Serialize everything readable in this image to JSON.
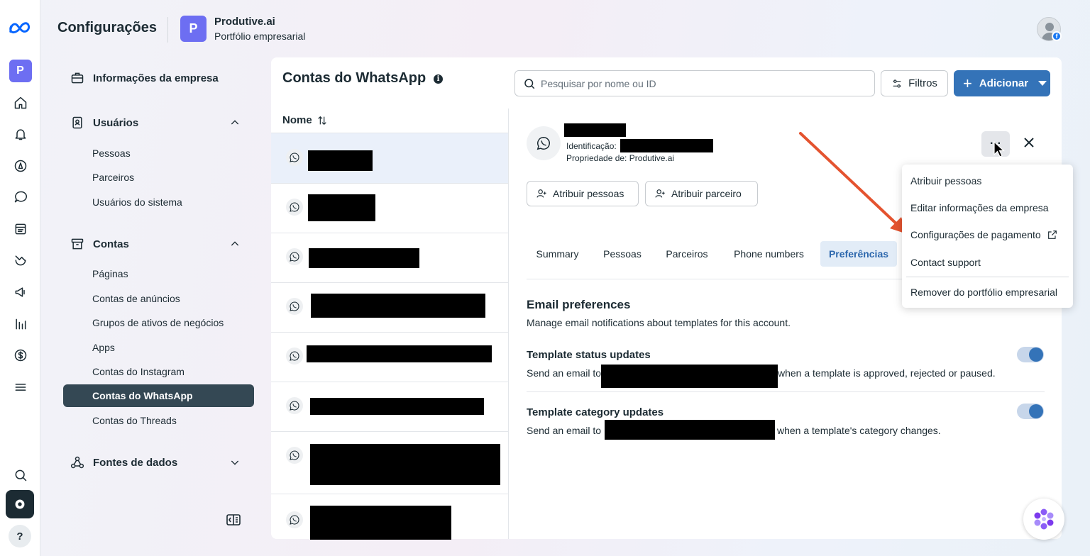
{
  "header": {
    "title": "Configurações",
    "business_initial": "P",
    "business_name": "Produtive.ai",
    "business_subtitle": "Portfólio empresarial"
  },
  "rail": {
    "business_initial": "P",
    "help": "?"
  },
  "sidebar": {
    "company_info": "Informações da empresa",
    "users": {
      "label": "Usuários",
      "items": [
        "Pessoas",
        "Parceiros",
        "Usuários do sistema"
      ]
    },
    "accounts": {
      "label": "Contas",
      "items": [
        "Páginas",
        "Contas de anúncios",
        "Grupos de ativos de negócios",
        "Apps",
        "Contas do Instagram",
        "Contas do WhatsApp",
        "Contas do Threads"
      ]
    },
    "data_sources": "Fontes de dados"
  },
  "panel": {
    "title": "Contas do WhatsApp",
    "info": "i",
    "search_placeholder": "Pesquisar por nome ou ID",
    "filter_label": "Filtros",
    "add_label": "Adicionar",
    "list_header": "Nome"
  },
  "detail": {
    "id_label": "Identificação:",
    "owner": "Propriedade de: Produtive.ai",
    "more": "···",
    "assign_people": "Atribuir pessoas",
    "assign_partner": "Atribuir parceiro",
    "tabs": [
      "Summary",
      "Pessoas",
      "Parceiros",
      "Phone numbers",
      "Preferências"
    ],
    "active_tab": "Preferências",
    "email_prefs_title": "Email preferences",
    "email_prefs_desc": "Manage email notifications about templates for this account.",
    "status_title": "Template status updates",
    "status_prefix": "Send an email to",
    "status_suffix": "when a template is approved, rejected or paused.",
    "status_enabled": true,
    "category_title": "Template category updates",
    "category_prefix": "Send an email to",
    "category_suffix": "when a template's category changes.",
    "category_enabled": true
  },
  "menu": {
    "items": [
      "Atribuir pessoas",
      "Editar informações da empresa",
      "Configurações de pagamento",
      "Contact support",
      "Remover do portfólio empresarial"
    ]
  },
  "colors": {
    "accent": "#3473b8",
    "brand_badge": "#6d6ef2",
    "annotation_arrow": "#e4532f"
  }
}
